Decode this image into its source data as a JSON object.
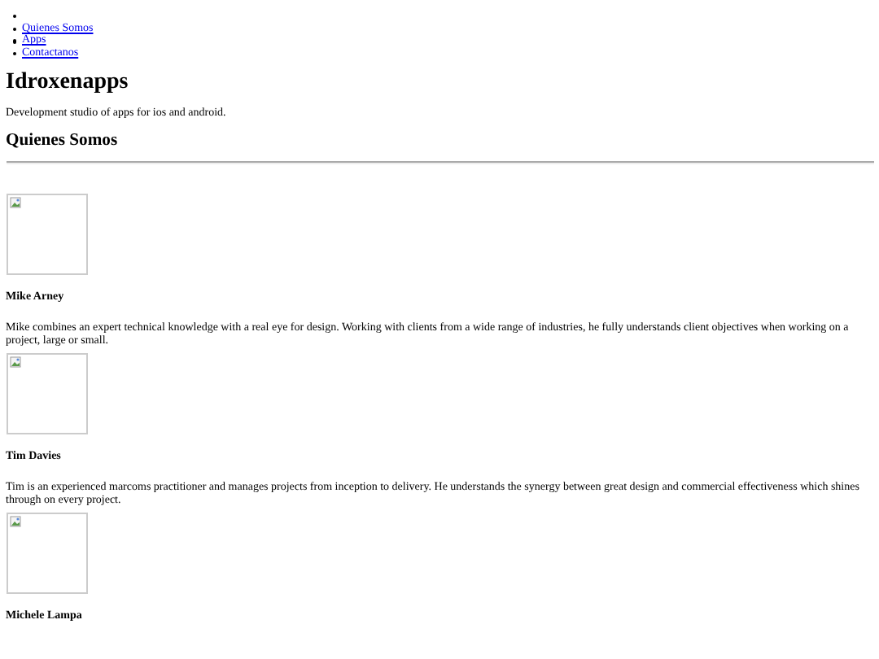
{
  "nav": {
    "items": [
      {
        "label": "Quienes Somos"
      },
      {
        "label": "Apps"
      },
      {
        "label": "Contactanos"
      }
    ]
  },
  "site": {
    "title": "Idroxenapps",
    "tagline": "Development studio of apps for ios and android."
  },
  "section": {
    "heading": "Quienes Somos"
  },
  "team": [
    {
      "name": "Mike Arney",
      "bio": "Mike combines an expert technical knowledge with a real eye for design. Working with clients from a wide range of industries, he fully understands client objectives when working on a project, large or small."
    },
    {
      "name": "Tim Davies",
      "bio": "Tim is an experienced marcoms practitioner and manages projects from inception to delivery. He understands the synergy between great design and commercial effectiveness which shines through on every project."
    },
    {
      "name": "Michele Lampa"
    }
  ]
}
